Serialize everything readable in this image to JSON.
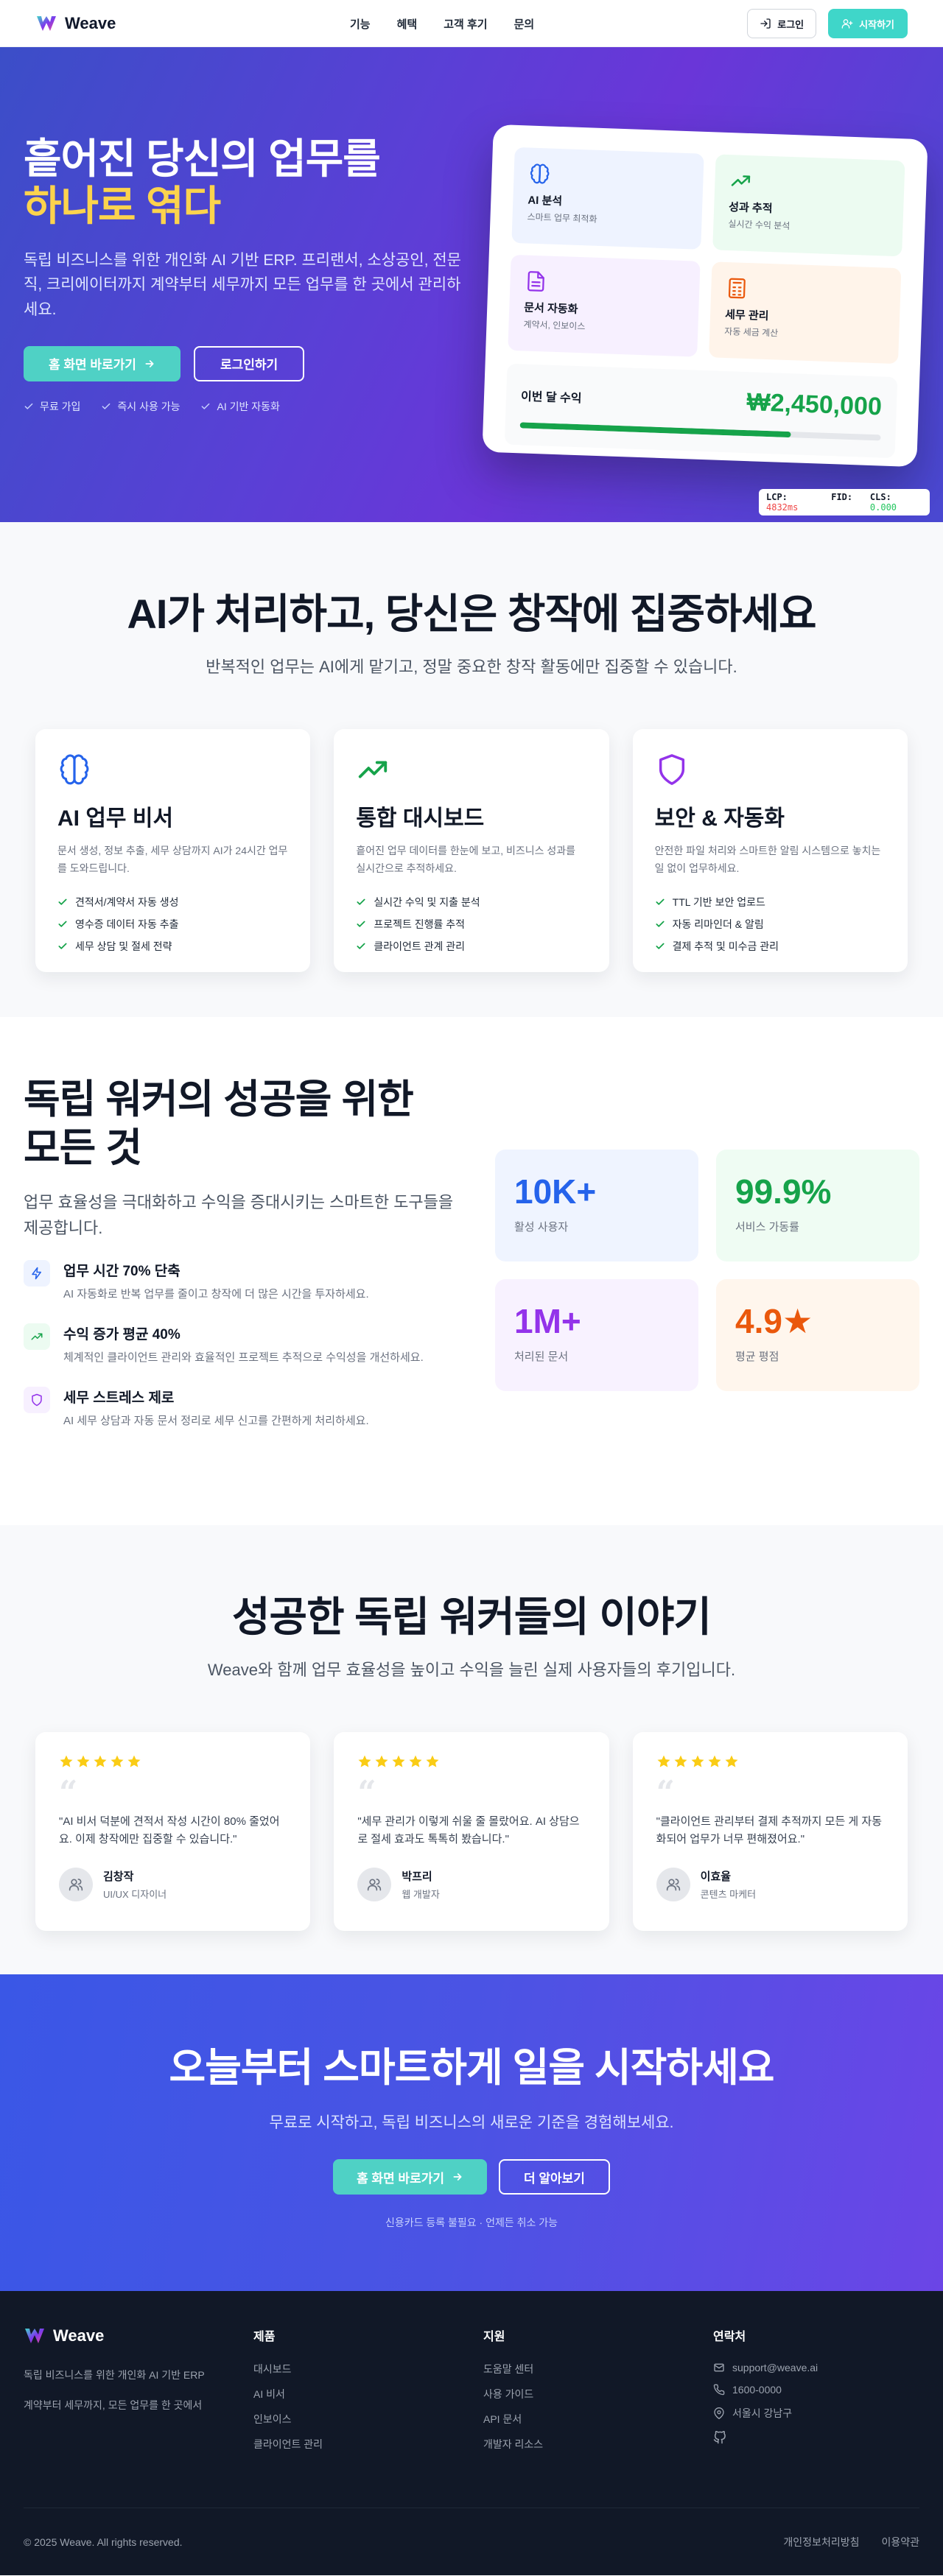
{
  "colors": {
    "accent": "#3fd6c9",
    "brand_purple": "#6a36d8",
    "success": "#16a34a",
    "highlight": "#fcd34d",
    "dark": "#111827"
  },
  "nav": {
    "brand": "Weave",
    "links": [
      "기능",
      "혜택",
      "고객 후기",
      "문의"
    ],
    "login_label": "로그인",
    "start_label": "시작하기"
  },
  "hero": {
    "title_line1": "흩어진 당신의 업무를",
    "title_line2": "하나로 엮다",
    "subtitle": "독립 비즈니스를 위한 개인화 AI 기반 ERP. 프리랜서, 소상공인, 전문직, 크리에이터까지 계약부터 세무까지 모든 업무를 한 곳에서 관리하세요.",
    "primary_button": "홈 화면 바로가기",
    "secondary_button": "로그인하기",
    "checks": [
      "무료 가입",
      "즉시 사용 가능",
      "AI 기반 자동화"
    ],
    "mockup": {
      "cards": [
        {
          "title": "AI 분석",
          "sub": "스마트 업무 최적화",
          "icon": "brain-icon"
        },
        {
          "title": "성과 추적",
          "sub": "실시간 수익 분석",
          "icon": "trending-up-icon"
        },
        {
          "title": "문서 자동화",
          "sub": "계약서, 인보이스",
          "icon": "document-icon"
        },
        {
          "title": "세무 관리",
          "sub": "자동 세금 계산",
          "icon": "calculator-icon"
        }
      ],
      "revenue_label": "이번 달 수익",
      "revenue_value": "₩2,450,000",
      "revenue_progress": 0.75
    },
    "perf": {
      "lcp_label": "LCP:",
      "lcp_value": "4832ms",
      "fid_label": "FID:",
      "fid_value": "-",
      "cls_label": "CLS:",
      "cls_value": "0.000"
    }
  },
  "features": {
    "title": "AI가 처리하고, 당신은 창작에 집중하세요",
    "subtitle": "반복적인 업무는 AI에게 맡기고, 정말 중요한 창작 활동에만 집중할 수 있습니다.",
    "cards": [
      {
        "title": "AI 업무 비서",
        "icon": "brain-icon",
        "desc": "문서 생성, 정보 추출, 세무 상담까지 AI가 24시간 업무를 도와드립니다.",
        "items": [
          "견적서/계약서 자동 생성",
          "영수증 데이터 자동 추출",
          "세무 상담 및 절세 전략"
        ]
      },
      {
        "title": "통합 대시보드",
        "icon": "trending-up-icon",
        "desc": "흩어진 업무 데이터를 한눈에 보고, 비즈니스 성과를 실시간으로 추적하세요.",
        "items": [
          "실시간 수익 및 지출 분석",
          "프로젝트 진행률 추적",
          "클라이언트 관계 관리"
        ]
      },
      {
        "title": "보안 & 자동화",
        "icon": "shield-icon",
        "desc": "안전한 파일 처리와 스마트한 알림 시스템으로 놓치는 일 없이 업무하세요.",
        "items": [
          "TTL 기반 보안 업로드",
          "자동 리마인더 & 알림",
          "결제 추적 및 미수금 관리"
        ]
      }
    ]
  },
  "stats": {
    "title_line1": "독립 워커의 성공을 위한",
    "title_line2": "모든 것",
    "subtitle": "업무 효율성을 극대화하고 수익을 증대시키는 스마트한 도구들을 제공합니다.",
    "benefits": [
      {
        "title": "업무 시간 70% 단축",
        "desc": "AI 자동화로 반복 업무를 줄이고 창작에 더 많은 시간을 투자하세요.",
        "icon": "lightning-icon"
      },
      {
        "title": "수익 증가 평균 40%",
        "desc": "체계적인 클라이언트 관리와 효율적인 프로젝트 추적으로 수익성을 개선하세요.",
        "icon": "trending-up-icon"
      },
      {
        "title": "세무 스트레스 제로",
        "desc": "AI 세무 상담과 자동 문서 정리로 세무 신고를 간편하게 처리하세요.",
        "icon": "shield-icon"
      }
    ],
    "items": [
      {
        "value": "10K+",
        "label": "활성 사용자",
        "color": "#2563eb",
        "bg": "#eff4ff"
      },
      {
        "value": "99.9%",
        "label": "서비스 가동률",
        "color": "#16a34a",
        "bg": "#effcf3"
      },
      {
        "value": "1M+",
        "label": "처리된 문서",
        "color": "#9333ea",
        "bg": "#f8f2ff"
      },
      {
        "value": "4.9★",
        "label": "평균 평점",
        "color": "#ea580c",
        "bg": "#fff6ed"
      }
    ]
  },
  "testimonials": {
    "title": "성공한 독립 워커들의 이야기",
    "subtitle": "Weave와 함께 업무 효율성을 높이고 수익을 늘린 실제 사용자들의 후기입니다.",
    "items": [
      {
        "quote": "\"AI 비서 덕분에 견적서 작성 시간이 80% 줄었어요. 이제 창작에만 집중할 수 있습니다.\"",
        "name": "김창작",
        "role": "UI/UX 디자이너",
        "rating": 5
      },
      {
        "quote": "\"세무 관리가 이렇게 쉬울 줄 몰랐어요. AI 상담으로 절세 효과도 톡톡히 봤습니다.\"",
        "name": "박프리",
        "role": "웹 개발자",
        "rating": 5
      },
      {
        "quote": "\"클라이언트 관리부터 결제 추적까지 모든 게 자동화되어 업무가 너무 편해졌어요.\"",
        "name": "이효율",
        "role": "콘텐츠 마케터",
        "rating": 5
      }
    ]
  },
  "cta": {
    "title": "오늘부터 스마트하게 일을 시작하세요",
    "subtitle": "무료로 시작하고, 독립 비즈니스의 새로운 기준을 경험해보세요.",
    "primary_button": "홈 화면 바로가기",
    "secondary_button": "더 알아보기",
    "note": "신용카드 등록 불필요 · 언제든 취소 가능"
  },
  "footer": {
    "brand": "Weave",
    "desc_line1": "독립 비즈니스를 위한 개인화 AI 기반 ERP",
    "desc_line2": "계약부터 세무까지, 모든 업무를 한 곳에서",
    "columns": [
      {
        "title": "제품",
        "links": [
          "대시보드",
          "AI 비서",
          "인보이스",
          "클라이언트 관리"
        ]
      },
      {
        "title": "지원",
        "links": [
          "도움말 센터",
          "사용 가이드",
          "API 문서",
          "개발자 리소스"
        ]
      }
    ],
    "contact_title": "연락처",
    "contact": {
      "email": "support@weave.ai",
      "phone": "1600-0000",
      "address": "서울시 강남구"
    },
    "copyright": "© 2025 Weave. All rights reserved.",
    "legal": [
      "개인정보처리방침",
      "이용약관"
    ]
  }
}
